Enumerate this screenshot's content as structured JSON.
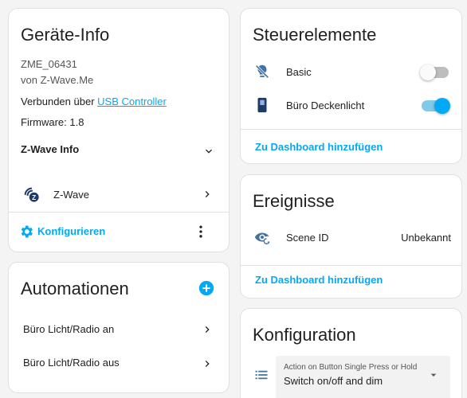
{
  "device_info": {
    "title": "Geräte-Info",
    "model": "ZME_06431",
    "manufacturer": "von Z-Wave.Me",
    "connected_prefix": "Verbunden über",
    "connected_link": "USB Controller",
    "firmware": "Firmware: 1.8",
    "zwave_info_label": "Z-Wave Info",
    "integration_label": "Z-Wave",
    "configure_label": "Konfigurieren"
  },
  "automations": {
    "title": "Automationen",
    "items": [
      {
        "label": "Büro Licht/Radio an"
      },
      {
        "label": "Büro Licht/Radio aus"
      }
    ]
  },
  "controls": {
    "title": "Steuerelemente",
    "items": [
      {
        "label": "Basic",
        "icon": "lightbulb-off-icon",
        "state": "off"
      },
      {
        "label": "Büro Deckenlicht",
        "icon": "light-switch-icon",
        "state": "on"
      }
    ],
    "action_label": "Zu Dashboard hinzufügen"
  },
  "events": {
    "title": "Ereignisse",
    "items": [
      {
        "label": "Scene ID",
        "value": "Unbekannt",
        "icon": "eye-refresh-icon"
      }
    ],
    "action_label": "Zu Dashboard hinzufügen"
  },
  "configuration": {
    "title": "Konfiguration",
    "select": {
      "label": "Action on Button Single Press or Hold",
      "value": "Switch on/off and dim"
    }
  },
  "colors": {
    "accent": "#03a9f4",
    "toggle_on_track": "#81c9ea",
    "toggle_off_track": "#bdbdbd",
    "icon_gray": "#44739e"
  }
}
